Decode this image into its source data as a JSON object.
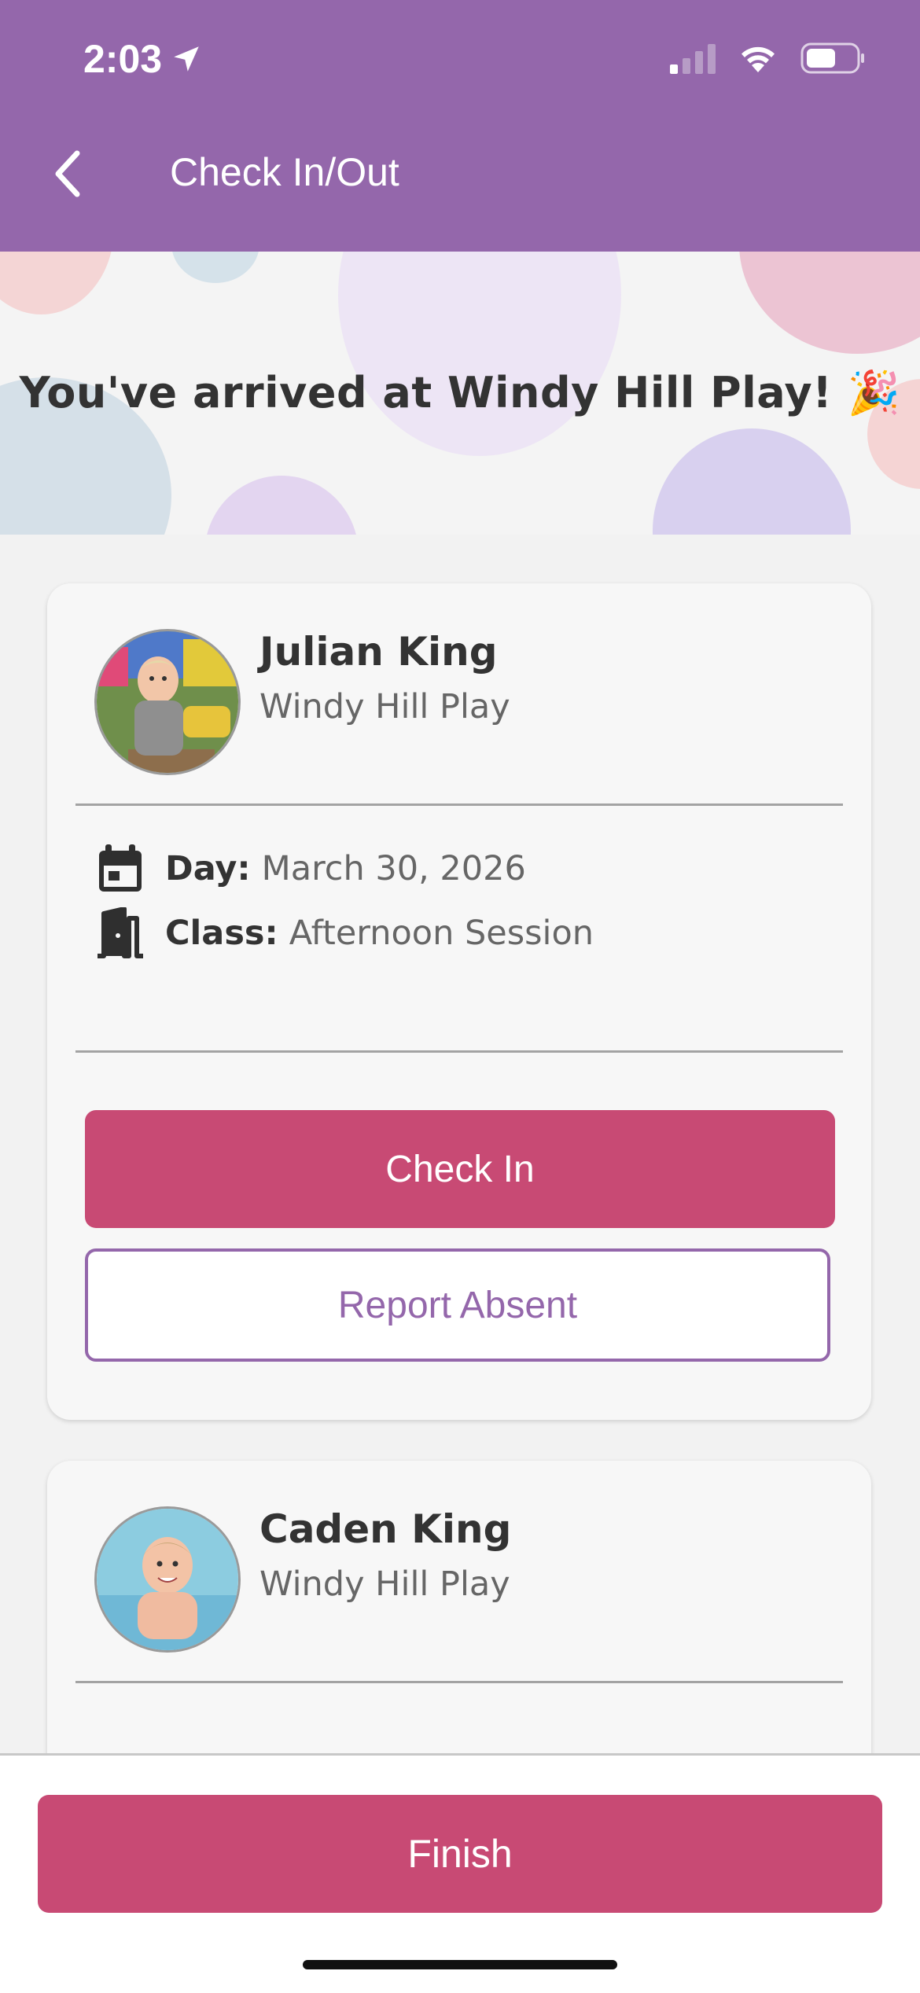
{
  "status_bar": {
    "time": "2:03"
  },
  "header": {
    "title": "Check In/Out"
  },
  "banner": {
    "message": "You've arrived at Windy Hill Play! 🎉"
  },
  "children": [
    {
      "name": "Julian  King",
      "school": "Windy Hill Play",
      "day_label": "Day:",
      "day_value": "March 30, 2026",
      "class_label": "Class:",
      "class_value": "Afternoon Session",
      "check_in_label": "Check In",
      "report_absent_label": "Report Absent"
    },
    {
      "name": "Caden King",
      "school": "Windy Hill Play"
    }
  ],
  "footer": {
    "finish_label": "Finish"
  },
  "colors": {
    "brand_purple": "#9467ab",
    "primary_pink": "#c84a74"
  }
}
